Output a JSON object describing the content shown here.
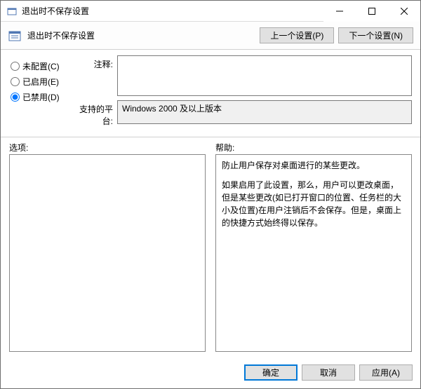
{
  "window": {
    "title": "退出时不保存设置"
  },
  "header": {
    "title": "退出时不保存设置",
    "prev_btn": "上一个设置(P)",
    "next_btn": "下一个设置(N)"
  },
  "radios": {
    "not_configured": "未配置(C)",
    "enabled": "已启用(E)",
    "disabled": "已禁用(D)",
    "selected": "disabled"
  },
  "fields": {
    "comment_label": "注释:",
    "comment_value": "",
    "platform_label": "支持的平台:",
    "platform_value": "Windows 2000 及以上版本"
  },
  "lower": {
    "options_label": "选项:",
    "help_label": "帮助:",
    "help_paragraphs": [
      "防止用户保存对桌面进行的某些更改。",
      "如果启用了此设置，那么，用户可以更改桌面，但是某些更改(如已打开窗口的位置、任务栏的大小及位置)在用户注销后不会保存。但是，桌面上的快捷方式始终得以保存。"
    ]
  },
  "footer": {
    "ok": "确定",
    "cancel": "取消",
    "apply": "应用(A)"
  }
}
